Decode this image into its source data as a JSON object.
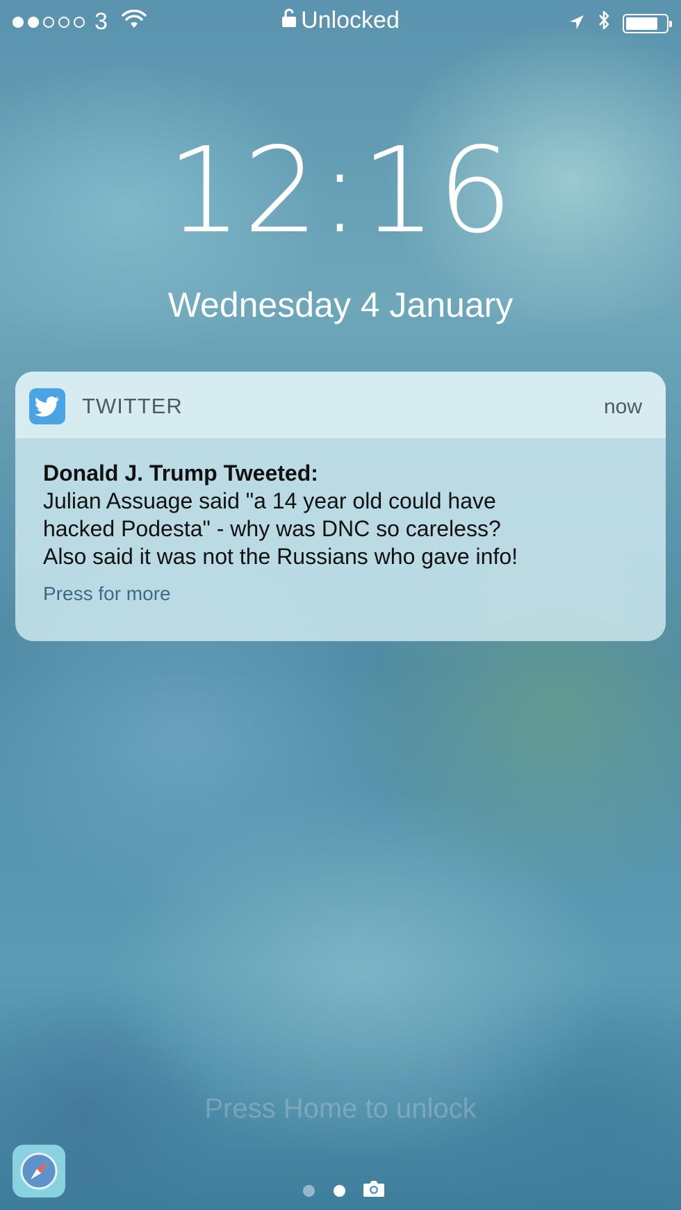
{
  "status_bar": {
    "signal_filled": 2,
    "signal_total": 5,
    "carrier": "3",
    "lock_status": "Unlocked",
    "battery_level": 0.8
  },
  "lockscreen": {
    "time": "12:16",
    "date": "Wednesday 4 January",
    "unlock_hint": "Press Home to unlock"
  },
  "notification": {
    "app_name": "TWITTER",
    "time": "now",
    "title": "Donald J. Trump Tweeted:",
    "body_lines": [
      "Julian Assuage said \"a 14 year old could have",
      "hacked Podesta\" - why was DNC so careless?",
      "Also said it was not the Russians who gave info!"
    ],
    "more": "Press for more"
  },
  "icons": {
    "app": "twitter-bird-icon",
    "dock": "safari-compass-icon",
    "camera": "camera-icon"
  },
  "colors": {
    "twitter_blue": "#4aa3e2",
    "notification_bg": "#d6eef3"
  }
}
